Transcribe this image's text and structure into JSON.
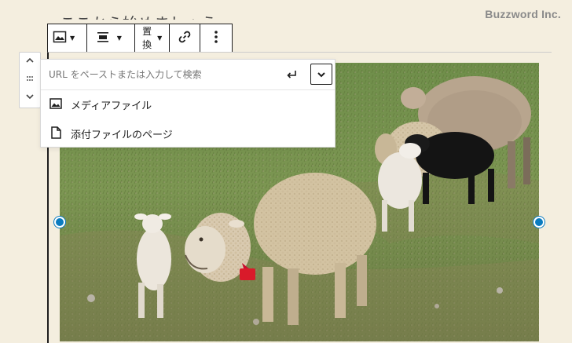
{
  "watermark": "Buzzword Inc.",
  "editor": {
    "heading_partial": "ここから始めましょう"
  },
  "toolbar": {
    "image_button_icon": "image-icon",
    "align_button_icon": "align-center-icon",
    "replace_label_line1": "置",
    "replace_label_line2": "換",
    "link_button_icon": "link-icon",
    "more_button_icon": "more-vertical-icon"
  },
  "mover": {
    "up_icon": "chevron-up-icon",
    "drag_icon": "drag-handle-icon",
    "down_icon": "chevron-down-icon"
  },
  "link_popover": {
    "url_placeholder": "URL をペーストまたは入力して検索",
    "submit_icon": "enter-icon",
    "toggle_icon": "chevron-down-icon",
    "options": [
      {
        "label": "メディアファイル",
        "icon": "image-icon"
      },
      {
        "label": "添付ファイルのページ",
        "icon": "page-icon"
      }
    ]
  },
  "colors": {
    "background": "#f4eedf",
    "handle": "#0a7bbf",
    "watermark": "#8a8a8a"
  }
}
